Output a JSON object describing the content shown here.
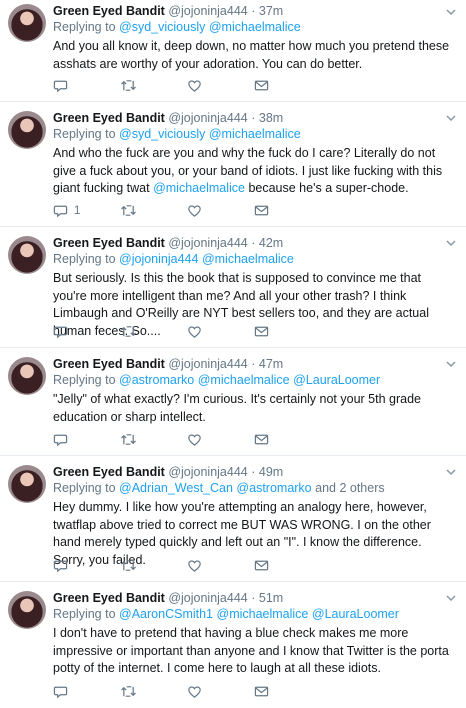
{
  "tweets": [
    {
      "name": "Green Eyed Bandit",
      "handle": "@jojoninja444",
      "time": "· 37m",
      "replying_label": "Replying to",
      "mentions": [
        "@syd_viciously",
        "@michaelmalice"
      ],
      "text": "And you all know it, deep down, no matter how much you pretend these asshats are worthy of your adoration. You can do better.",
      "reply_count": ""
    },
    {
      "name": "Green Eyed Bandit",
      "handle": "@jojoninja444",
      "time": "· 38m",
      "replying_label": "Replying to",
      "mentions": [
        "@syd_viciously",
        "@michaelmalice"
      ],
      "text": "And who the fuck are you and why the fuck do I care? Literally do not give a fuck about you, or your band of idiots. I just like fucking with this giant fucking twat",
      "text_mention": "@michaelmalice",
      "text_after": "because he's a super-chode.",
      "reply_count": "1"
    },
    {
      "name": "Green Eyed Bandit",
      "handle": "@jojoninja444",
      "time": "· 42m",
      "replying_label": "Replying to",
      "mentions": [
        "@jojoninja444",
        "@michaelmalice"
      ],
      "text": "But seriously. Is this the book that is supposed to convince me that you're more intelligent than me? And all your other trash? I think Limbaugh and O'Reilly are NYT best sellers too, and they are actual human feces. So....",
      "reply_count": ""
    },
    {
      "name": "Green Eyed Bandit",
      "handle": "@jojoninja444",
      "time": "· 47m",
      "replying_label": "Replying to",
      "mentions": [
        "@astromarko",
        "@michaelmalice",
        "@LauraLoomer"
      ],
      "text": "\"Jelly\" of what exactly? I'm curious. It's certainly not your 5th grade education or sharp intellect.",
      "reply_count": ""
    },
    {
      "name": "Green Eyed Bandit",
      "handle": "@jojoninja444",
      "time": "· 49m",
      "replying_label": "Replying to",
      "mentions": [
        "@Adrian_West_Can",
        "@astromarko"
      ],
      "others": "and 2 others",
      "text": "Hey dummy. I like how you're attempting an analogy here, however, twatflap above tried to correct me BUT WAS WRONG. I on the other hand merely typed quickly and left out an \"I\". I know the difference. Sorry, you failed.",
      "reply_count": ""
    },
    {
      "name": "Green Eyed Bandit",
      "handle": "@jojoninja444",
      "time": "· 51m",
      "replying_label": "Replying to",
      "mentions": [
        "@AaronCSmith1",
        "@michaelmalice",
        "@LauraLoomer"
      ],
      "text": "I don't have to pretend that having a blue check makes me more impressive or important than anyone and I know that Twitter is the porta potty of the internet. I come here to laugh at all these idiots.",
      "reply_count": ""
    }
  ],
  "icons": {
    "reply": "reply-icon",
    "retweet": "retweet-icon",
    "like": "heart-icon",
    "message": "envelope-icon",
    "caret": "chevron-down-icon"
  },
  "colors": {
    "link": "#1da1f2",
    "meta": "#657786",
    "text": "#14171a",
    "divider": "#e6ecf0"
  }
}
